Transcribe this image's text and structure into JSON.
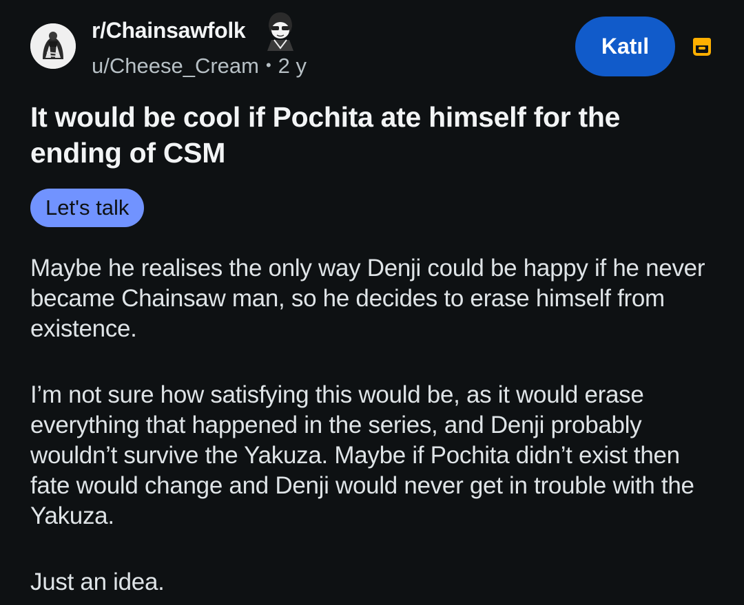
{
  "header": {
    "subreddit": "r/Chainsawfolk",
    "username": "u/Cheese_Cream",
    "separator": "•",
    "age": "2 y",
    "join_label": "Katıl"
  },
  "post": {
    "title": "It would be cool if Pochita ate himself for the ending of CSM",
    "flair": "Let's talk",
    "paragraphs": [
      "Maybe he realises the only way Denji could be happy if he never became Chainsaw man, so he decides to erase himself from existence.",
      "I’m not sure how satisfying this would be, as it would erase everything that happened in the series, and Denji probably wouldn’t survive the Yakuza. Maybe if Pochita didn’t exist then fate would change and Denji would never get in trouble with the Yakuza.",
      "Just an idea."
    ]
  },
  "icons": {
    "avatar": "subreddit-avatar",
    "user_flair": "user-flair-image",
    "archive": "archive-icon"
  },
  "colors": {
    "background": "#0e1113",
    "join_button": "#115bca",
    "flair_pill": "#7193ff",
    "archive_icon": "#ffb000"
  }
}
